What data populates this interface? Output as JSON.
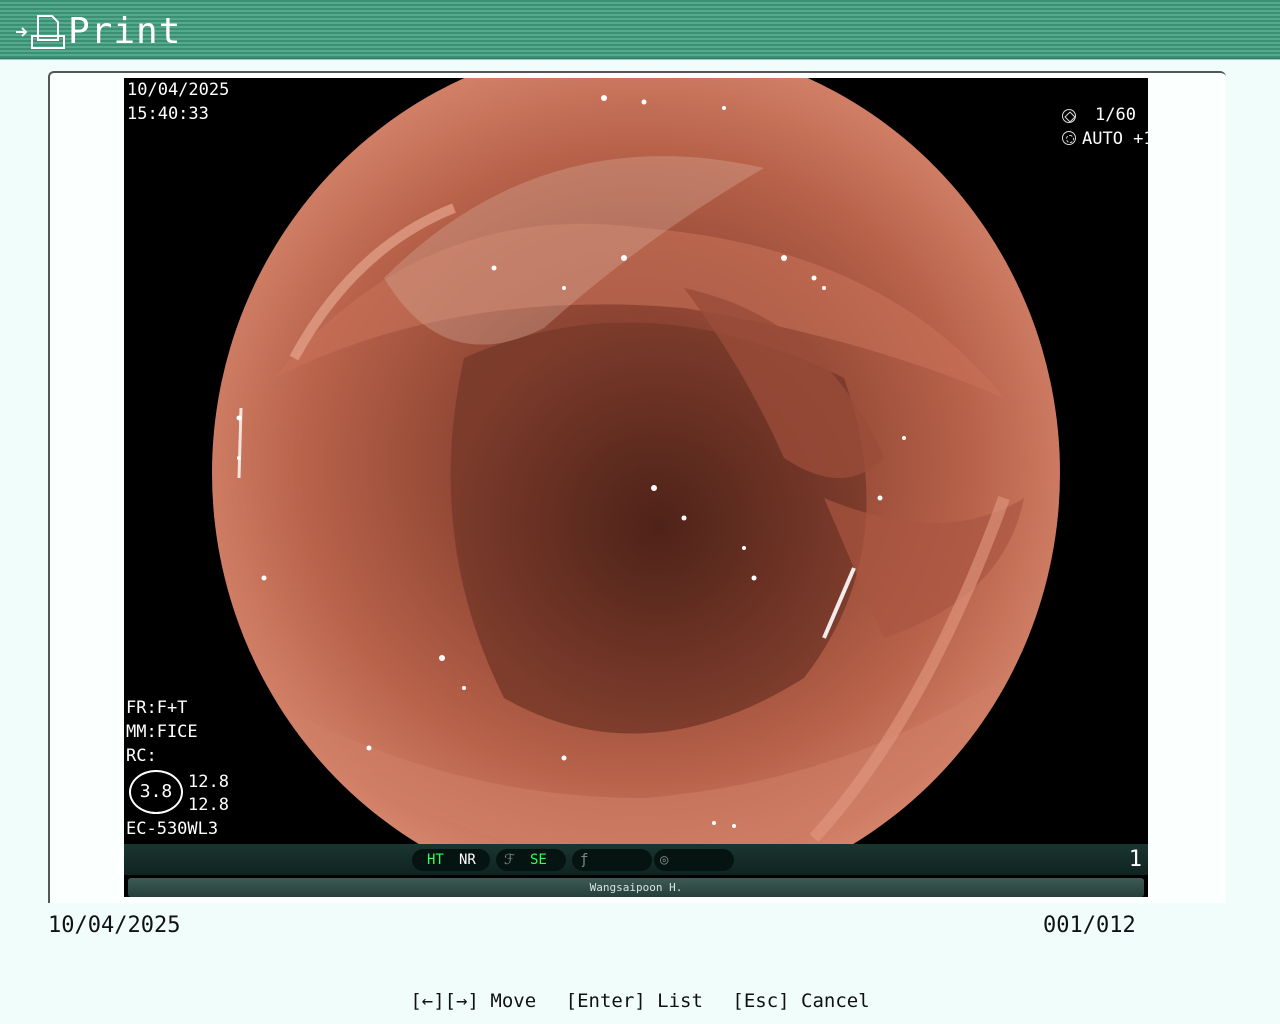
{
  "window": {
    "title": "Print",
    "title_icon": "print-arrow-icon",
    "accent_color": "#3b8f73"
  },
  "image": {
    "date": "10/04/2025",
    "time": "15:40:33",
    "shutter": "1/60",
    "iris": "AUTO +1",
    "fr": "FR:F+T",
    "mm": "MM:FICE",
    "rc": "RC:",
    "ratio": "3.8",
    "zoom_a": "12.8",
    "zoom_b": "12.8",
    "scope_model": "EC-530WL3",
    "status": {
      "ht": "HT",
      "nr": "NR",
      "se": "SE",
      "frame_number": "1"
    },
    "doctor": "Wangsaipoon H."
  },
  "footer": {
    "date": "10/04/2025",
    "counter": "001/012"
  },
  "help": {
    "move": "[←][→] Move",
    "list": "[Enter] List",
    "cancel": "[Esc] Cancel"
  }
}
